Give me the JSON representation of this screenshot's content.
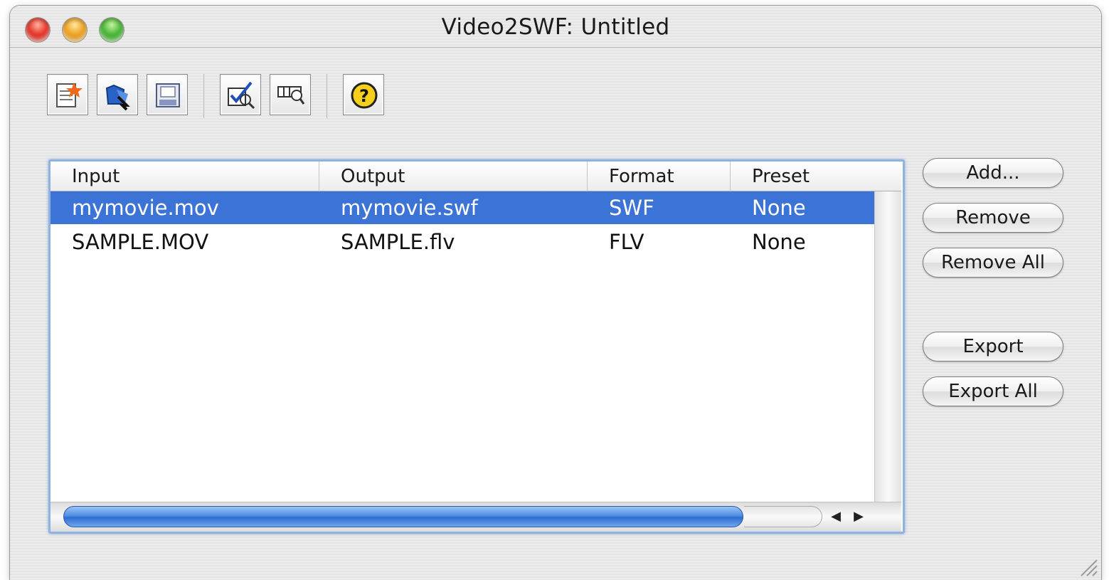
{
  "window": {
    "title": "Video2SWF: Untitled"
  },
  "toolbar": {
    "buttons": [
      {
        "name": "new-document-button",
        "icon": "new-document-icon"
      },
      {
        "name": "open-button",
        "icon": "open-folder-icon"
      },
      {
        "name": "save-button",
        "icon": "save-disk-icon"
      },
      {
        "name": "check-settings-button",
        "icon": "checkmark-magnifier-icon"
      },
      {
        "name": "preview-button",
        "icon": "preview-magnifier-icon"
      },
      {
        "name": "help-button",
        "icon": "help-question-icon"
      }
    ]
  },
  "table": {
    "columns": [
      "Input",
      "Output",
      "Format",
      "Preset"
    ],
    "rows": [
      {
        "input": "mymovie.mov",
        "output": "mymovie.swf",
        "format": "SWF",
        "preset": "None",
        "selected": true
      },
      {
        "input": "SAMPLE.MOV",
        "output": "SAMPLE.flv",
        "format": "FLV",
        "preset": "None",
        "selected": false
      }
    ]
  },
  "actions": {
    "add": "Add...",
    "remove": "Remove",
    "remove_all": "Remove All",
    "export": "Export",
    "export_all": "Export All"
  },
  "colors": {
    "selection": "#3b73d6",
    "focus_ring": "#8fb3de",
    "scroll_thumb": "#4e8ee6"
  }
}
